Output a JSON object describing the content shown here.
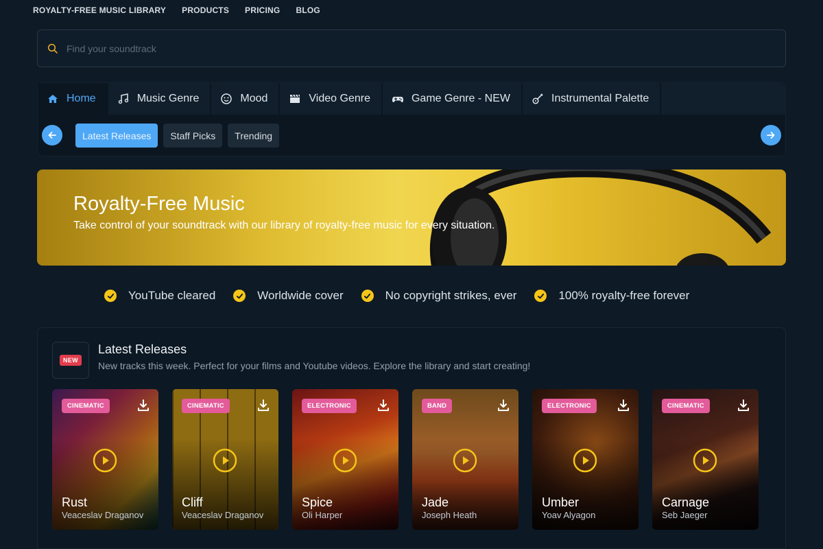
{
  "topnav": [
    "ROYALTY-FREE MUSIC LIBRARY",
    "PRODUCTS",
    "PRICING",
    "BLOG"
  ],
  "search": {
    "placeholder": "Find your soundtrack",
    "icon": "search-icon"
  },
  "tabs": [
    {
      "label": "Home",
      "icon": "home-icon",
      "active": true
    },
    {
      "label": "Music Genre",
      "icon": "music-note-icon"
    },
    {
      "label": "Mood",
      "icon": "smiley-icon"
    },
    {
      "label": "Video Genre",
      "icon": "clapperboard-icon"
    },
    {
      "label": "Game Genre - NEW",
      "icon": "gamepad-icon"
    },
    {
      "label": "Instrumental Palette",
      "icon": "guitar-icon"
    }
  ],
  "subtabs": [
    {
      "label": "Latest Releases",
      "active": true
    },
    {
      "label": "Staff Picks"
    },
    {
      "label": "Trending"
    }
  ],
  "hero": {
    "title": "Royalty-Free Music",
    "subtitle": "Take control of your soundtrack with our library of royalty-free music for every situation."
  },
  "features": [
    "YouTube cleared",
    "Worldwide cover",
    "No copyright strikes, ever",
    "100% royalty-free forever"
  ],
  "latest": {
    "badge": "NEW",
    "title": "Latest Releases",
    "subtitle": "New tracks this week. Perfect for your films and Youtube videos. Explore the library and start creating!",
    "tracks": [
      {
        "genre": "CINEMATIC",
        "title": "Rust",
        "artist": "Veaceslav Draganov"
      },
      {
        "genre": "CINEMATIC",
        "title": "Cliff",
        "artist": "Veaceslav Draganov"
      },
      {
        "genre": "ELECTRONIC",
        "title": "Spice",
        "artist": "Oli Harper"
      },
      {
        "genre": "BAND",
        "title": "Jade",
        "artist": "Joseph Heath"
      },
      {
        "genre": "ELECTRONIC",
        "title": "Umber",
        "artist": "Yoav Alyagon"
      },
      {
        "genre": "CINEMATIC",
        "title": "Carnage",
        "artist": "Seb Jaeger"
      }
    ]
  },
  "colors": {
    "background": "#0e1a26",
    "accent": "#4fa8f5",
    "check": "#f5c518",
    "genre_badge": "#e35b9a",
    "new_badge": "#e23d4d"
  }
}
